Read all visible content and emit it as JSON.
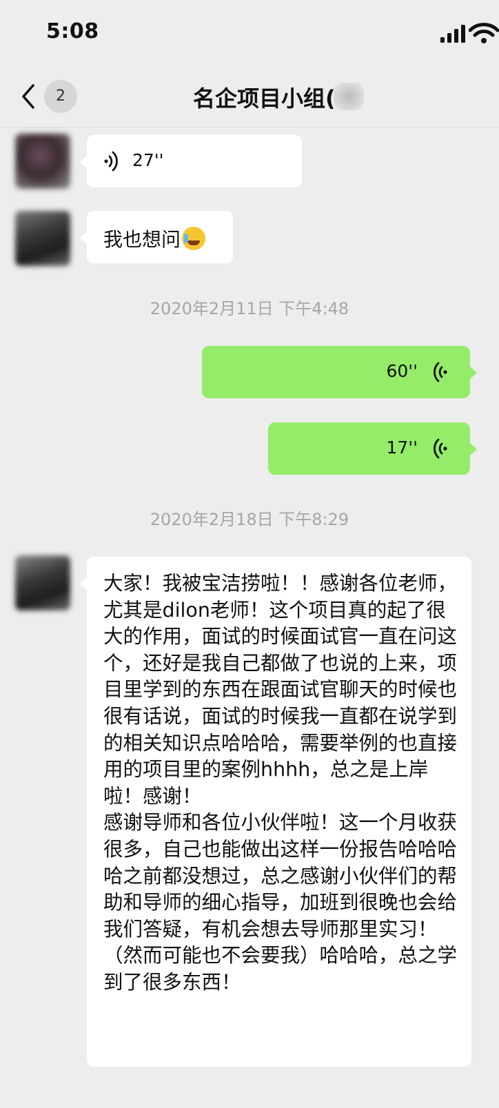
{
  "status_bar": {
    "time": "5:08"
  },
  "nav": {
    "unread_count": "2",
    "title": "名企项目小组("
  },
  "messages": {
    "voice_incoming": {
      "duration": "27''"
    },
    "text_incoming_short": {
      "text": "我也想问",
      "emoji": "crying-laughing-emoji"
    },
    "timestamp_1": "2020年2月11日 下午4:48",
    "voice_outgoing_1": {
      "duration": "60''"
    },
    "voice_outgoing_2": {
      "duration": "17''"
    },
    "timestamp_2": "2020年2月18日 下午8:29",
    "text_incoming_long": {
      "text": "大家！我被宝洁捞啦！！感谢各位老师，尤其是dilon老师！这个项目真的起了很大的作用，面试的时候面试官一直在问这个，还好是我自己都做了也说的上来，项目里学到的东西在跟面试官聊天的时候也很有话说，面试的时候我一直都在说学到的相关知识点哈哈哈，需要举例的也直接用的项目里的案例hhhh，总之是上岸啦！感谢！\n感谢导师和各位小伙伴啦！这一个月收获很多，自己也能做出这样一份报告哈哈哈哈之前都没想过，总之感谢小伙伴们的帮助和导师的细心指导，加班到很晚也会给我们答疑，有机会想去导师那里实习！（然而可能也不会要我）哈哈哈，总之学到了很多东西！"
    }
  },
  "colors": {
    "background": "#ededed",
    "outgoing_bubble": "#95ec69",
    "incoming_bubble": "#ffffff",
    "timestamp": "#a6a6a6"
  },
  "icons": [
    "signal-icon",
    "wifi-icon",
    "back-chevron-icon",
    "voice-wave-icon",
    "avatar"
  ]
}
